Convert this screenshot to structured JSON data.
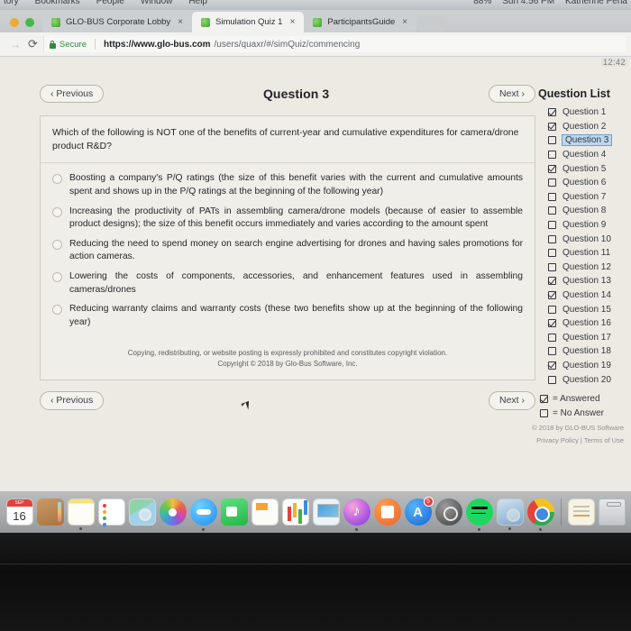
{
  "menubar": {
    "left_items": [
      "tory",
      "Bookmarks",
      "People",
      "Window",
      "Help"
    ],
    "right_items": [
      "88%",
      "Sun 4:56 PM",
      "Katherine Pena"
    ]
  },
  "browser": {
    "tabs": [
      {
        "title": "GLO-BUS Corporate Lobby",
        "close": "×",
        "active": false
      },
      {
        "title": "Simulation Quiz 1",
        "close": "×",
        "active": true
      },
      {
        "title": "ParticipantsGuide",
        "close": "×",
        "active": false
      }
    ],
    "reload_glyph": "⟳",
    "back_glyph": "→",
    "security_label": "Secure",
    "url_domain": "https://www.glo-bus.com",
    "url_path": "/users/quaxr/#/simQuiz/commencing"
  },
  "page": {
    "clock": "12:42",
    "nav": {
      "previous_label": "‹ Previous",
      "next_label": "Next ›"
    },
    "question_title": "Question 3",
    "question_stem": "Which of the following is NOT one of the benefits of current-year and cumulative expenditures for camera/drone product R&D?",
    "answers": [
      "Boosting a company's P/Q ratings (the size of this benefit varies with the current and cumulative amounts spent and shows up in the P/Q ratings at the beginning of the following year)",
      "Increasing the productivity of PATs in assembling camera/drone models (because of easier to assemble product designs); the size of this benefit occurs immediately and varies according to the amount spent",
      "Reducing the need to spend money on search engine advertising for drones and having sales promotions for action cameras.",
      "Lowering the costs of components, accessories, and enhancement features used in assembling cameras/drones",
      "Reducing warranty claims and warranty costs (these two benefits show up at the beginning of the following year)"
    ],
    "copyright_line1": "Copying, redistributing, or website posting is expressly prohibited and constitutes copyright violation.",
    "copyright_line2": "Copyright © 2018 by Glo-Bus Software, Inc.",
    "footer_copyright": "© 2018 by GLO-BUS Software",
    "footer_links": "Privacy Policy | Terms of Use"
  },
  "question_list": {
    "title": "Question List",
    "items": [
      {
        "label": "Question 1",
        "answered": true,
        "selected": false
      },
      {
        "label": "Question 2",
        "answered": true,
        "selected": false
      },
      {
        "label": "Question 3",
        "answered": false,
        "selected": true
      },
      {
        "label": "Question 4",
        "answered": false,
        "selected": false
      },
      {
        "label": "Question 5",
        "answered": true,
        "selected": false
      },
      {
        "label": "Question 6",
        "answered": false,
        "selected": false
      },
      {
        "label": "Question 7",
        "answered": false,
        "selected": false
      },
      {
        "label": "Question 8",
        "answered": false,
        "selected": false
      },
      {
        "label": "Question 9",
        "answered": false,
        "selected": false
      },
      {
        "label": "Question 10",
        "answered": false,
        "selected": false
      },
      {
        "label": "Question 11",
        "answered": false,
        "selected": false
      },
      {
        "label": "Question 12",
        "answered": false,
        "selected": false
      },
      {
        "label": "Question 13",
        "answered": true,
        "selected": false
      },
      {
        "label": "Question 14",
        "answered": true,
        "selected": false
      },
      {
        "label": "Question 15",
        "answered": false,
        "selected": false
      },
      {
        "label": "Question 16",
        "answered": true,
        "selected": false
      },
      {
        "label": "Question 17",
        "answered": false,
        "selected": false
      },
      {
        "label": "Question 18",
        "answered": false,
        "selected": false
      },
      {
        "label": "Question 19",
        "answered": true,
        "selected": false
      },
      {
        "label": "Question 20",
        "answered": false,
        "selected": false
      }
    ],
    "legend": [
      {
        "label": "= Answered",
        "answered": true
      },
      {
        "label": "= No Answer",
        "answered": false
      }
    ]
  },
  "dock": {
    "calendar_month": "SEP",
    "calendar_day": "16",
    "appstore_badge": "5",
    "items": [
      {
        "name": "calendar",
        "class": "ic-calendar",
        "running": false
      },
      {
        "name": "contacts",
        "class": "ic-contacts",
        "running": false
      },
      {
        "name": "notes",
        "class": "ic-notes",
        "running": true
      },
      {
        "name": "reminders",
        "class": "ic-reminders",
        "running": false
      },
      {
        "name": "maps",
        "class": "ic-maps",
        "running": false
      },
      {
        "name": "photos",
        "class": "ic-photos",
        "running": false
      },
      {
        "name": "messages",
        "class": "ic-messages",
        "running": true
      },
      {
        "name": "facetime",
        "class": "ic-facetime",
        "running": false
      },
      {
        "name": "pages",
        "class": "ic-pages",
        "running": false
      },
      {
        "name": "numbers",
        "class": "ic-numbers",
        "running": false
      },
      {
        "name": "keynote",
        "class": "ic-keynote",
        "running": false
      },
      {
        "name": "itunes",
        "class": "ic-itunes",
        "running": true
      },
      {
        "name": "ibooks",
        "class": "ic-ibooks",
        "running": false
      },
      {
        "name": "app-store",
        "class": "ic-appstore",
        "running": false
      },
      {
        "name": "system-preferences",
        "class": "ic-sysprefs",
        "running": false
      },
      {
        "name": "spotify",
        "class": "ic-spotify",
        "running": true
      },
      {
        "name": "preview",
        "class": "ic-preview",
        "running": true
      },
      {
        "name": "chrome",
        "class": "ic-chrome",
        "running": true
      }
    ],
    "right_items": [
      {
        "name": "stickies",
        "class": "ic-stickies"
      },
      {
        "name": "trash",
        "class": "ic-trash"
      }
    ]
  }
}
